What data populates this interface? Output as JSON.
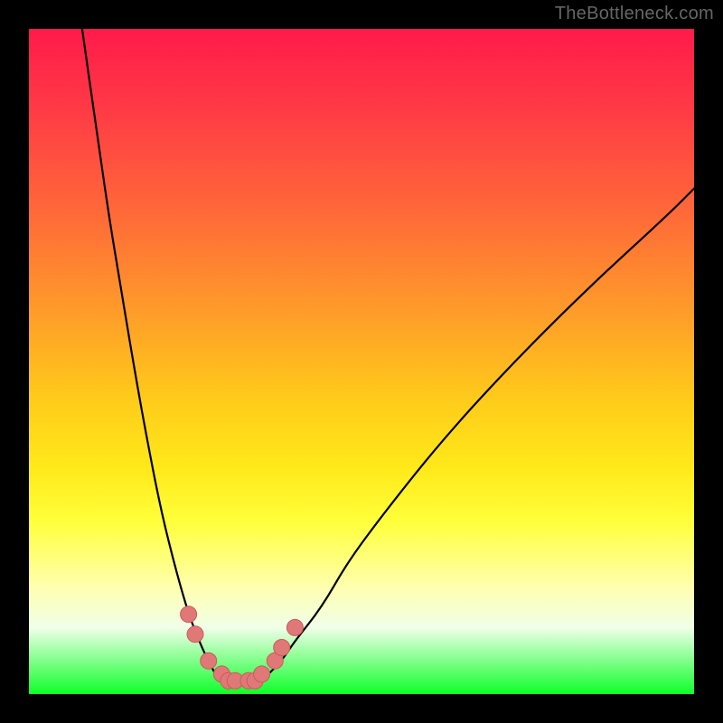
{
  "watermark": "TheBottleneck.com",
  "colors": {
    "frame": "#000000",
    "gradient_top": "#ff1a4a",
    "gradient_bottom": "#0fff2a",
    "curve": "#000000",
    "beads": "#e07878"
  },
  "chart_data": {
    "type": "line",
    "title": "",
    "xlabel": "",
    "ylabel": "",
    "xlim": [
      0,
      100
    ],
    "ylim": [
      0,
      100
    ],
    "grid": false,
    "note": "Heat-gradient plot with V-shaped curve; no axis ticks or numeric labels are shown, so x/y values are geometric estimates read off the figure in percent coordinates.",
    "series": [
      {
        "name": "left-branch",
        "x": [
          8,
          10,
          12,
          14,
          16,
          18,
          20,
          22,
          24,
          26,
          27,
          28,
          29,
          30
        ],
        "y": [
          100,
          86,
          72,
          60,
          48,
          37,
          27,
          19,
          12,
          7,
          5,
          3,
          2,
          2
        ]
      },
      {
        "name": "right-branch",
        "x": [
          34,
          35,
          36,
          38,
          40,
          44,
          48,
          54,
          62,
          72,
          84,
          96,
          100
        ],
        "y": [
          2,
          2,
          3,
          5,
          8,
          13,
          20,
          28,
          38,
          49,
          61,
          72,
          76
        ]
      }
    ],
    "markers": [
      {
        "name": "bead",
        "x": 24,
        "y": 12,
        "series": "left-branch"
      },
      {
        "name": "bead",
        "x": 25,
        "y": 9,
        "series": "left-branch"
      },
      {
        "name": "bead",
        "x": 27,
        "y": 5,
        "series": "left-branch"
      },
      {
        "name": "bead",
        "x": 29,
        "y": 3,
        "series": "left-branch"
      },
      {
        "name": "bead",
        "x": 30,
        "y": 2,
        "series": "left-branch"
      },
      {
        "name": "bead",
        "x": 31,
        "y": 2,
        "series": "floor"
      },
      {
        "name": "bead",
        "x": 33,
        "y": 2,
        "series": "floor"
      },
      {
        "name": "bead",
        "x": 34,
        "y": 2,
        "series": "right-branch"
      },
      {
        "name": "bead",
        "x": 35,
        "y": 3,
        "series": "right-branch"
      },
      {
        "name": "bead",
        "x": 37,
        "y": 5,
        "series": "right-branch"
      },
      {
        "name": "bead",
        "x": 38,
        "y": 7,
        "series": "right-branch"
      },
      {
        "name": "bead",
        "x": 40,
        "y": 10,
        "series": "right-branch"
      }
    ]
  }
}
